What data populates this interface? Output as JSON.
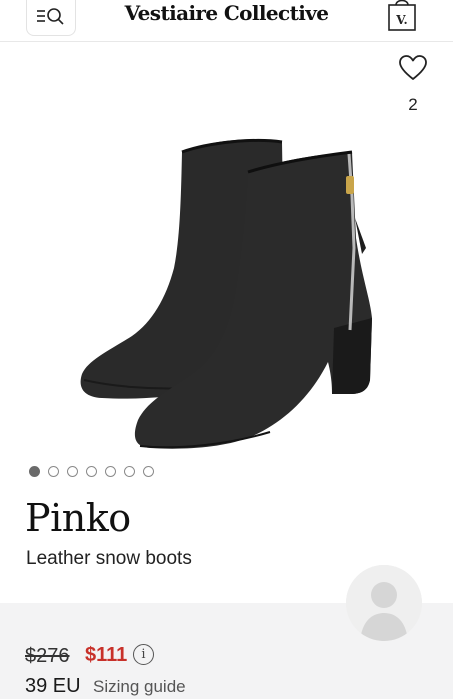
{
  "header": {
    "logo": "Vestiaire Collective",
    "bag_letter": "V."
  },
  "icons": {
    "menu": "menu-search-icon",
    "bag": "shopping-bag-icon",
    "favorite": "heart-icon",
    "info": "info-icon",
    "avatar": "user-avatar-placeholder"
  },
  "favorites": {
    "count": "2"
  },
  "carousel": {
    "total": 7,
    "active_index": 0
  },
  "product": {
    "brand": "Pinko",
    "name": "Leather snow boots"
  },
  "price": {
    "original": "$276",
    "current": "$111",
    "info_glyph": "i"
  },
  "size": {
    "value": "39 EU",
    "guide_label": "Sizing guide"
  },
  "colors": {
    "sale_price": "#c8312a",
    "panel_bg": "#f3f3f4",
    "text": "#1a1a1a"
  }
}
